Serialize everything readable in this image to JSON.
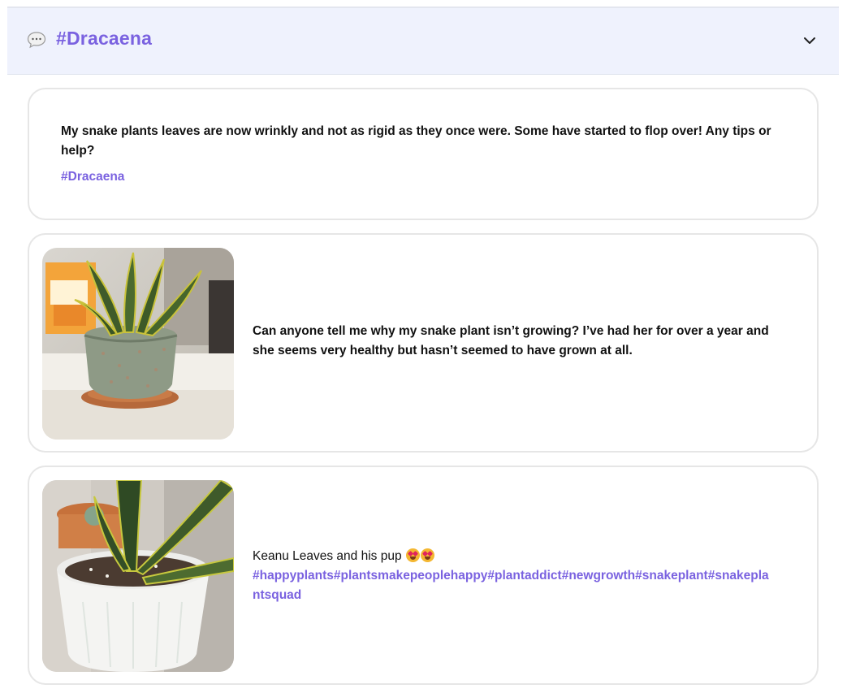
{
  "header": {
    "title": "#Dracaena",
    "icon": "chat-bubble-icon",
    "toggle_icon": "chevron-down-icon"
  },
  "posts": [
    {
      "text": "My snake plants leaves are now wrinkly and not as rigid as they once were. Some have started to flop over! Any tips or help?",
      "tags": "#Dracaena"
    },
    {
      "image": "snake-plant-in-speckled-pot-photo",
      "text": "Can anyone tell me why my snake plant isn’t growing? I’ve had her for over a year and she seems very healthy but hasn’t seemed to have grown at all."
    },
    {
      "image": "snake-plant-in-white-pot-photo",
      "text": "Keanu Leaves and his pup",
      "emoji": "heart-eyes-emoji",
      "tags_line1": "#happyplants#plantsmakepeoplehappy#plantaddict#newgrowth#snakeplant#snakepla",
      "tags_line2": "ntsquad"
    }
  ],
  "colors": {
    "accent": "#7a62e0",
    "header_bg": "#eff2fd",
    "card_border": "#e6e6e6"
  }
}
